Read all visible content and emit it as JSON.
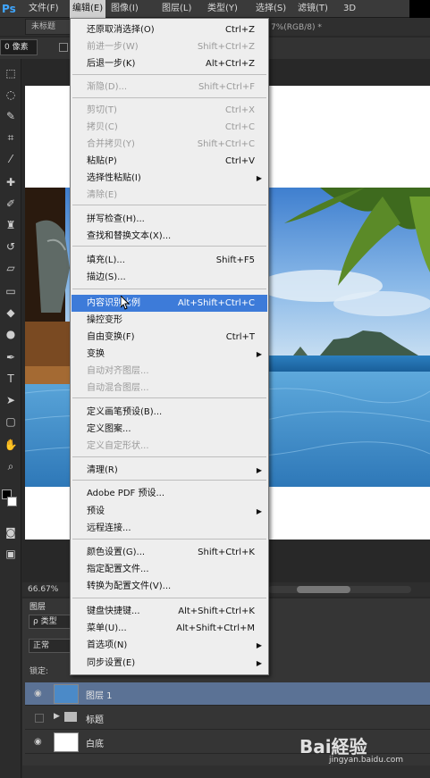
{
  "menubar": {
    "logo": "Ps",
    "items": [
      "文件(F)",
      "编辑(E)",
      "图像(I)",
      "图层(L)",
      "类型(Y)",
      "选择(S)",
      "滤镜(T)",
      "3D"
    ]
  },
  "document": {
    "tab_title": "未标题",
    "tab_info": "7%(RGB/8) *",
    "feather_value": "0 像素",
    "zoom": "66.67%"
  },
  "edit_menu": {
    "items": [
      {
        "label": "还原取消选择(O)",
        "shortcut": "Ctrl+Z",
        "enabled": true
      },
      {
        "label": "前进一步(W)",
        "shortcut": "Shift+Ctrl+Z",
        "enabled": false
      },
      {
        "label": "后退一步(K)",
        "shortcut": "Alt+Ctrl+Z",
        "enabled": true
      },
      {
        "label": "渐隐(D)...",
        "shortcut": "Shift+Ctrl+F",
        "enabled": false
      },
      {
        "label": "剪切(T)",
        "shortcut": "Ctrl+X",
        "enabled": false
      },
      {
        "label": "拷贝(C)",
        "shortcut": "Ctrl+C",
        "enabled": false
      },
      {
        "label": "合并拷贝(Y)",
        "shortcut": "Shift+Ctrl+C",
        "enabled": false
      },
      {
        "label": "粘贴(P)",
        "shortcut": "Ctrl+V",
        "enabled": true
      },
      {
        "label": "选择性粘贴(I)",
        "shortcut": "",
        "enabled": true,
        "submenu": true
      },
      {
        "label": "清除(E)",
        "shortcut": "",
        "enabled": false
      },
      {
        "label": "拼写检查(H)...",
        "shortcut": "",
        "enabled": true
      },
      {
        "label": "查找和替换文本(X)...",
        "shortcut": "",
        "enabled": true
      },
      {
        "label": "填充(L)...",
        "shortcut": "Shift+F5",
        "enabled": true
      },
      {
        "label": "描边(S)...",
        "shortcut": "",
        "enabled": true
      },
      {
        "label": "内容识别比例",
        "shortcut": "Alt+Shift+Ctrl+C",
        "enabled": true,
        "highlighted": true
      },
      {
        "label": "操控变形",
        "shortcut": "",
        "enabled": true
      },
      {
        "label": "自由变换(F)",
        "shortcut": "Ctrl+T",
        "enabled": true
      },
      {
        "label": "变换",
        "shortcut": "",
        "enabled": true,
        "submenu": true
      },
      {
        "label": "自动对齐图层...",
        "shortcut": "",
        "enabled": false
      },
      {
        "label": "自动混合图层...",
        "shortcut": "",
        "enabled": false
      },
      {
        "label": "定义画笔预设(B)...",
        "shortcut": "",
        "enabled": true
      },
      {
        "label": "定义图案...",
        "shortcut": "",
        "enabled": true
      },
      {
        "label": "定义自定形状...",
        "shortcut": "",
        "enabled": false
      },
      {
        "label": "清理(R)",
        "shortcut": "",
        "enabled": true,
        "submenu": true
      },
      {
        "label": "Adobe PDF 预设...",
        "shortcut": "",
        "enabled": true
      },
      {
        "label": "预设",
        "shortcut": "",
        "enabled": true,
        "submenu": true
      },
      {
        "label": "远程连接...",
        "shortcut": "",
        "enabled": true
      },
      {
        "label": "颜色设置(G)...",
        "shortcut": "Shift+Ctrl+K",
        "enabled": true
      },
      {
        "label": "指定配置文件...",
        "shortcut": "",
        "enabled": true
      },
      {
        "label": "转换为配置文件(V)...",
        "shortcut": "",
        "enabled": true
      },
      {
        "label": "键盘快捷键...",
        "shortcut": "Alt+Shift+Ctrl+K",
        "enabled": true
      },
      {
        "label": "菜单(U)...",
        "shortcut": "Alt+Shift+Ctrl+M",
        "enabled": true
      },
      {
        "label": "首选项(N)",
        "shortcut": "",
        "enabled": true,
        "submenu": true
      },
      {
        "label": "同步设置(E)",
        "shortcut": "",
        "enabled": true,
        "submenu": true
      }
    ]
  },
  "layers": {
    "tab": "图层",
    "kind_filter": "ρ 类型",
    "blend_mode": "正常",
    "lock_label": "锁定:",
    "rows": [
      {
        "name": "图层 1",
        "selected": true
      },
      {
        "name": "标题",
        "selected": false,
        "group": true
      },
      {
        "name": "白底",
        "selected": false
      }
    ]
  },
  "watermark": {
    "text": "Bai経验",
    "url": "jingyan.baidu.com"
  },
  "colors": {
    "highlight": "#3d7bd9",
    "selected_layer": "#5b7295"
  }
}
